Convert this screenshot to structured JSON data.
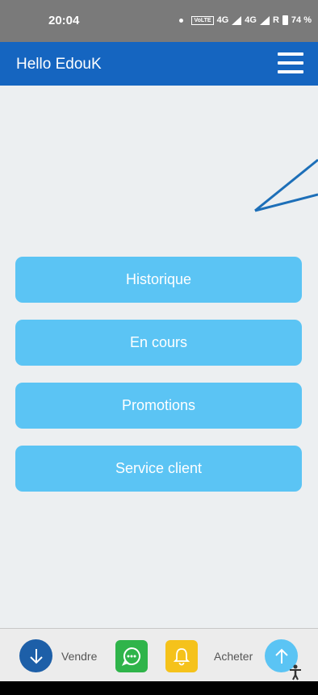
{
  "status_bar": {
    "time": "20:04",
    "network1": "4G",
    "network2": "4G",
    "roaming": "R",
    "volte": "VoLTE",
    "battery": "74 %"
  },
  "header": {
    "title": "Hello EdouK",
    "menu_icon": "hamburger-menu-icon"
  },
  "menu": {
    "items": [
      {
        "label": "Historique"
      },
      {
        "label": "En cours"
      },
      {
        "label": "Promotions"
      },
      {
        "label": "Service client"
      }
    ]
  },
  "bottom_bar": {
    "sell_label": "Vendre",
    "buy_label": "Acheter",
    "sell_icon": "arrow-down-icon",
    "buy_icon": "arrow-up-icon",
    "chat_icon": "chat-icon",
    "notification_icon": "bell-icon"
  },
  "colors": {
    "header": "#1565c0",
    "button": "#5bc4f4",
    "chat": "#2fb44a",
    "notification": "#f5c21b",
    "sell": "#1d5fa8",
    "buy": "#5bc4f4"
  }
}
